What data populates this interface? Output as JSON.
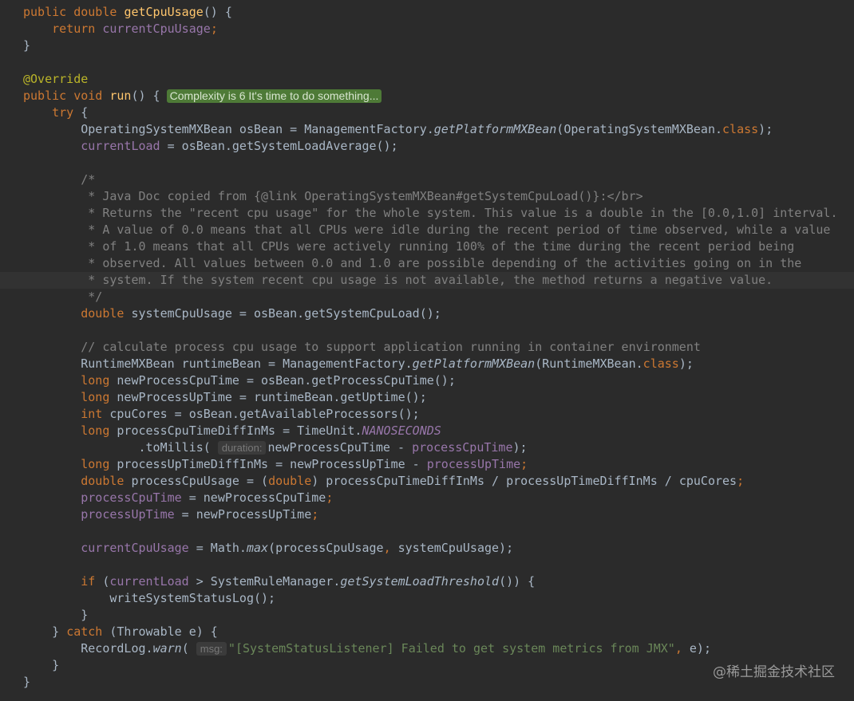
{
  "watermark": "@稀土掘金技术社区",
  "tokens": {
    "t_public": "public",
    "t_double": "double",
    "t_getCpuUsage": "getCpuUsage",
    "t_paren_open_close": "() {",
    "t_return": "return",
    "t_currentCpuUsage": "currentCpuUsage",
    "t_semi": ";",
    "t_close_brace": "}",
    "t_override": "@Override",
    "t_void": "void",
    "t_run": "run",
    "t_complexity": "Complexity is 6 It's time to do something...",
    "t_try_brace": " {",
    "t_try": "try",
    "t_osbean_decl": "OperatingSystemMXBean osBean = ManagementFactory.",
    "t_getPlatformMXBean": "getPlatformMXBean",
    "t_osbean_arg": "(OperatingSystemMXBean.",
    "t_class": "class",
    "t_close_paren_semi": ");",
    "t_currentLoad": "currentLoad",
    "t_load_rhs": " = osBean.getSystemLoadAverage();",
    "c1": "/*",
    "c2": " * Java Doc copied from {@link OperatingSystemMXBean#getSystemCpuLoad()}:</br>",
    "c3": " * Returns the \"recent cpu usage\" for the whole system. This value is a double in the [0.0,1.0] interval.",
    "c4": " * A value of 0.0 means that all CPUs were idle during the recent period of time observed, while a value",
    "c5": " * of 1.0 means that all CPUs were actively running 100% of the time during the recent period being",
    "c6": " * observed. All values between 0.0 and 1.0 are possible depending of the activities going on in the",
    "c7": " * system. If the system recent cpu usage is not available, the method returns a negative value.",
    "c8": " */",
    "t_sys_cpu": " systemCpuUsage = osBean.getSystemCpuLoad();",
    "c9": "// calculate process cpu usage to support application running in container environment",
    "t_runtime_decl": "RuntimeMXBean runtimeBean = ManagementFactory.",
    "t_runtime_arg": "(RuntimeMXBean.",
    "t_long": "long",
    "t_newProcCpu": " newProcessCpuTime = osBean.getProcessCpuTime();",
    "t_newProcUp": " newProcessUpTime = runtimeBean.getUptime();",
    "t_int": "int",
    "t_cores": " cpuCores = osBean.getAvailableProcessors();",
    "t_diff1": " processCpuTimeDiffInMs = TimeUnit.",
    "t_NANOSECONDS": "NANOSECONDS",
    "t_toMillis": ".toMillis(",
    "t_duration_hint": "duration:",
    "t_newProcCpuExpr": "newProcessCpuTime - ",
    "t_processCpuTime": "processCpuTime",
    "t_diff2": " processUpTimeDiffInMs = newProcessUpTime - ",
    "t_processUpTime": "processUpTime",
    "t_pcu_a": " processCpuUsage = (",
    "t_pcu_b": ") processCpuTimeDiffInMs / processUpTimeDiffInMs / cpuCores",
    "t_assign_cpu": " = newProcessCpuTime",
    "t_assign_up": " = newProcessUpTime",
    "t_math": " = Math.",
    "t_max": "max",
    "t_max_args1": "(processCpuUsage",
    "t_comma": ",",
    "t_max_args2": " systemCpuUsage);",
    "t_if": "if",
    "t_if_open": " (",
    "t_if_mid": " > SystemRuleManager.",
    "t_getThreshold": "getSystemLoadThreshold",
    "t_if_end": "()) {",
    "t_writeLog": "writeSystemStatusLog();",
    "t_close_pre": "} ",
    "t_catch": "catch",
    "t_catch_rest": " (Throwable e) {",
    "t_recordlog": "RecordLog.",
    "t_warn": "warn",
    "t_open_paren": "(",
    "t_msg_hint": "msg:",
    "t_msg_str": "\"[SystemStatusListener] Failed to get system metrics from JMX\"",
    "t_e_close": " e);"
  }
}
